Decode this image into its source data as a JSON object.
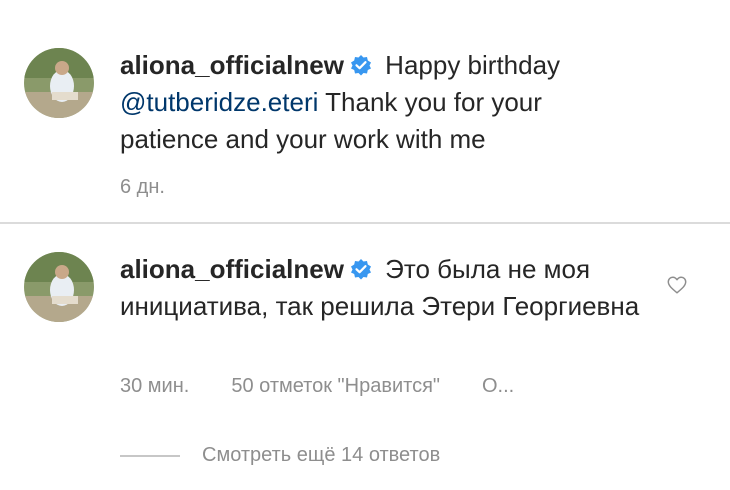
{
  "comments": [
    {
      "username": "aliona_officialnew",
      "text_before": " Happy birthday ",
      "mention": "@tutberidze.eteri",
      "text_after": " Thank you for your patience and your work with me",
      "time": "6 дн."
    },
    {
      "username": "aliona_officialnew",
      "text": " Это была не моя инициатива, так решила Этери Георгиевна",
      "time": "30 мин.",
      "likes": "50 отметок \"Нравится\"",
      "reply": "О..."
    }
  ],
  "view_more": "Смотреть ещё 14 ответов",
  "colors": {
    "verified": "#3897f0",
    "mention": "#00376b",
    "meta": "#8e8e8e"
  },
  "icons": [
    "verified-icon",
    "heart-icon"
  ]
}
